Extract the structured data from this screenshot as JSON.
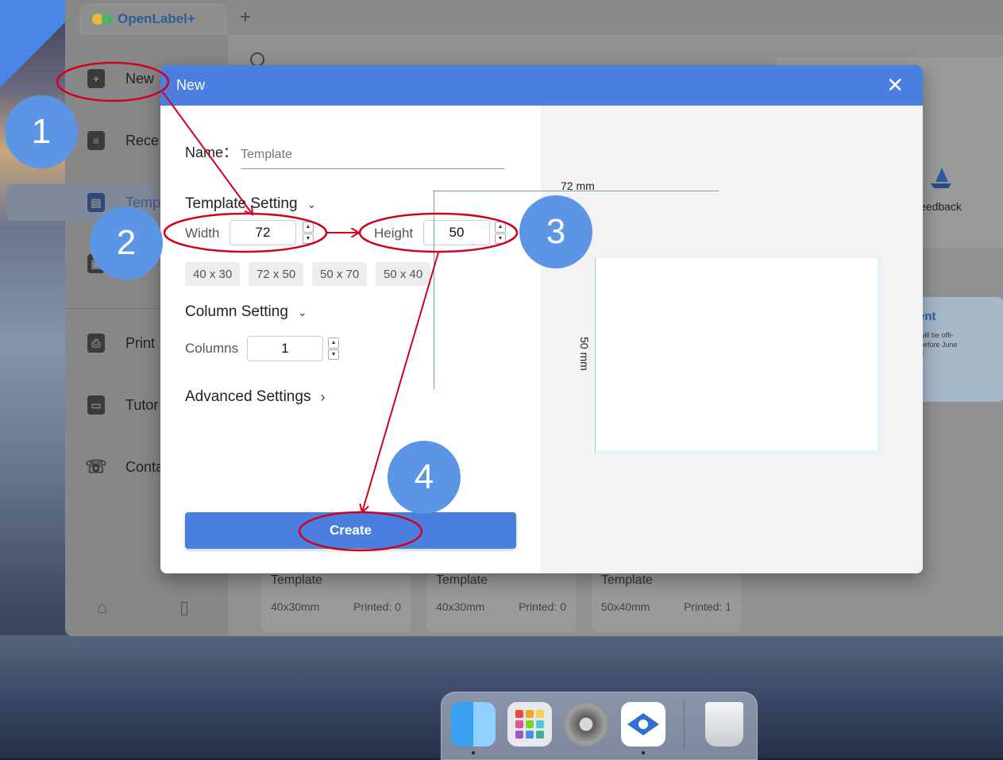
{
  "app": {
    "name": "OpenLabel+",
    "new_tab_symbol": "+"
  },
  "sidebar": {
    "items": [
      {
        "label": "New",
        "icon": "plus-document-icon"
      },
      {
        "label": "Rece",
        "icon": "recent-document-icon"
      },
      {
        "label": "Temp",
        "icon": "template-icon"
      },
      {
        "label": "Print",
        "icon": "printer-icon"
      },
      {
        "label": "Tutor",
        "icon": "tutorial-icon"
      },
      {
        "label": "Conta",
        "icon": "phone-icon"
      }
    ],
    "bottom_icons": [
      "home-icon",
      "device-icon"
    ]
  },
  "background": {
    "feedback_label": "eedback",
    "banner_title": "ent",
    "banner_lines": [
      "will be offi-",
      "before June",
      "d"
    ]
  },
  "template_cards": [
    {
      "name": "Template",
      "size": "40x30mm",
      "printed": "Printed: 0"
    },
    {
      "name": "Template",
      "size": "40x30mm",
      "printed": "Printed: 0"
    },
    {
      "name": "Template",
      "size": "50x40mm",
      "printed": "Printed: 1"
    }
  ],
  "modal": {
    "title": "New",
    "close_symbol": "✕",
    "name_label": "Name：",
    "name_placeholder": "Template",
    "template_setting": "Template Setting",
    "width_label": "Width",
    "width_value": "72",
    "height_label": "Height",
    "height_value": "50",
    "presets": [
      "40 x 30",
      "72 x 50",
      "50 x 70",
      "50 x 40"
    ],
    "column_setting": "Column Setting",
    "columns_label": "Columns",
    "columns_value": "1",
    "advanced_settings": "Advanced Settings",
    "create_label": "Create",
    "chevron_down": "⌄",
    "chevron_right": "›"
  },
  "preview": {
    "width_label": "72 mm",
    "height_label": "50 mm"
  },
  "steps": [
    "1",
    "2",
    "3",
    "4"
  ],
  "dock": {
    "items": [
      "finder-icon",
      "launchpad-icon",
      "system-settings-icon",
      "openlabel-icon",
      "trash-icon"
    ]
  },
  "colors": {
    "accent": "#4a7fe0",
    "badge": "#5c95e4",
    "annotation": "#d0021b"
  }
}
